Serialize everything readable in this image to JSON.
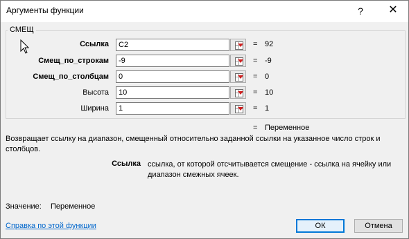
{
  "window": {
    "title": "Аргументы функции",
    "help_glyph": "?",
    "close_glyph": "✕"
  },
  "function_group": {
    "name": "СМЕЩ",
    "arguments": [
      {
        "label": "Ссылка",
        "required": true,
        "input": "C2",
        "eq": "=",
        "value": "92"
      },
      {
        "label": "Смещ_по_строкам",
        "required": true,
        "input": "-9",
        "eq": "=",
        "value": "-9"
      },
      {
        "label": "Смещ_по_столбцам",
        "required": true,
        "input": "0",
        "eq": "=",
        "value": "0"
      },
      {
        "label": "Высота",
        "required": false,
        "input": "10",
        "eq": "=",
        "value": "10"
      },
      {
        "label": "Ширина",
        "required": false,
        "input": "1",
        "eq": "=",
        "value": "1"
      }
    ]
  },
  "result": {
    "eq": "=",
    "value": "Переменное"
  },
  "description": "Возвращает ссылку на диапазон, смещенный относительно заданной ссылки на указанное число строк и столбцов.",
  "argument_help": {
    "name": "Ссылка",
    "text": "ссылка, от которой отсчитывается смещение - ссылка на ячейку или диапазон смежных ячеек."
  },
  "value_line": {
    "label": "Значение:",
    "value": "Переменное"
  },
  "footer": {
    "help_link": "Справка по этой функции",
    "ok_label": "ОК",
    "cancel_label": "Отмена"
  },
  "colors": {
    "link": "#0066cc",
    "accent": "#0078d7"
  }
}
